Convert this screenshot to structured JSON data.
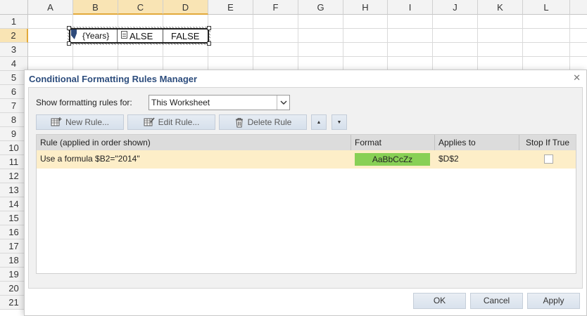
{
  "sheet": {
    "columns": [
      "A",
      "B",
      "C",
      "D",
      "E",
      "F",
      "G",
      "H",
      "I",
      "J",
      "K",
      "L"
    ],
    "rows": [
      "1",
      "2",
      "3",
      "4",
      "5",
      "6",
      "7",
      "8",
      "9",
      "10",
      "11",
      "12",
      "13",
      "14",
      "15",
      "16",
      "17",
      "18",
      "19",
      "20",
      "21"
    ],
    "cells": {
      "B2": "{Years}",
      "C2": "ALSE",
      "D2": "FALSE"
    },
    "selection_color": "#e2a93a"
  },
  "dialog": {
    "title": "Conditional Formatting Rules Manager",
    "show_rules_label": "Show formatting rules for:",
    "scope_value": "This Worksheet",
    "toolbar": {
      "new_rule": "New Rule...",
      "edit_rule": "Edit Rule...",
      "delete_rule": "Delete Rule"
    },
    "table": {
      "headers": [
        "Rule (applied in order shown)",
        "Format",
        "Applies to",
        "Stop If True"
      ],
      "rows": [
        {
          "rule": "Use a formula $B2=\"2014\"",
          "format_preview": "AaBbCcZz",
          "format_color": "#88d055",
          "applies_to": "$D$2",
          "stop_if_true": false
        }
      ]
    },
    "buttons": {
      "ok": "OK",
      "cancel": "Cancel",
      "apply": "Apply"
    },
    "icons": {
      "close": "close-icon",
      "dropdown": "chevron-down-icon",
      "new_rule": "table-add-icon",
      "edit_rule": "table-edit-icon",
      "delete_rule": "trash-icon",
      "move_up": "arrow-up-icon",
      "move_down": "arrow-down-icon"
    }
  }
}
